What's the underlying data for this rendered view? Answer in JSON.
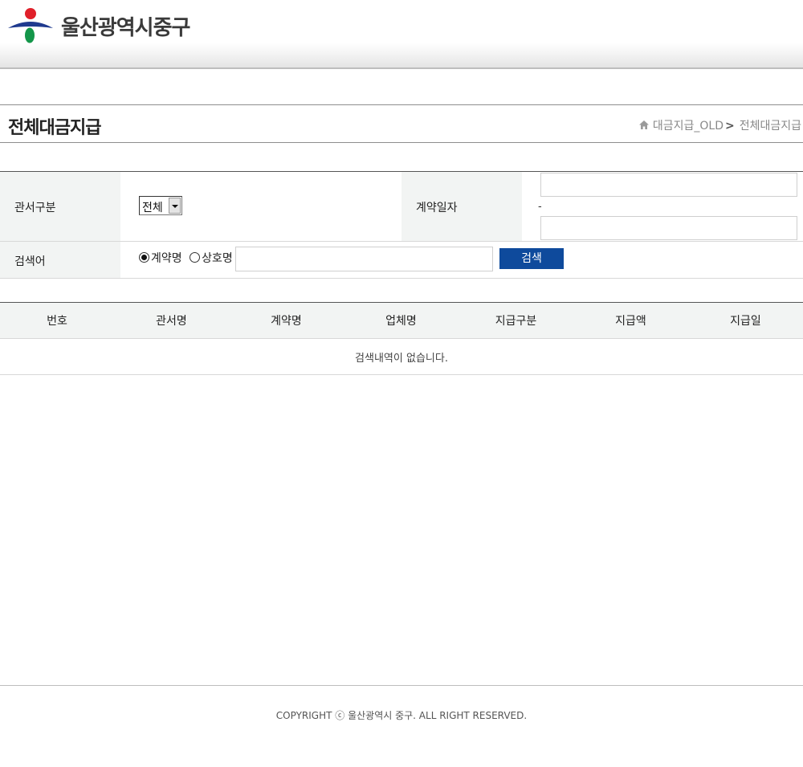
{
  "header": {
    "site_name": "울산광역시중구",
    "logo_colors": {
      "red": "#e0202a",
      "blue": "#1f3a8f",
      "green": "#14964a"
    }
  },
  "page": {
    "title": "전체대금지급",
    "breadcrumb": {
      "parent": "대금지급_OLD",
      "separator": ">",
      "current": "전체대금지급"
    }
  },
  "search_form": {
    "office_label": "관서구분",
    "office_select_value": "전체",
    "contract_date_label": "계약일자",
    "date_start_value": "",
    "date_separator": "-",
    "date_end_value": "",
    "keyword_label": "검색어",
    "radio_options": [
      {
        "label": "계약명",
        "checked": true
      },
      {
        "label": "상호명",
        "checked": false
      }
    ],
    "keyword_value": "",
    "search_button_label": "검색"
  },
  "results_table": {
    "columns": [
      "번호",
      "관서명",
      "계약명",
      "업체명",
      "지급구분",
      "지급액",
      "지급일"
    ],
    "empty_message": "검색내역이 없습니다."
  },
  "footer": {
    "copyright": "COPYRIGHT ⓒ 울산광역시 중구. ALL RIGHT RESERVED."
  },
  "colors": {
    "accent_button": "#0e4a9c",
    "label_background": "#f2f4f3"
  }
}
